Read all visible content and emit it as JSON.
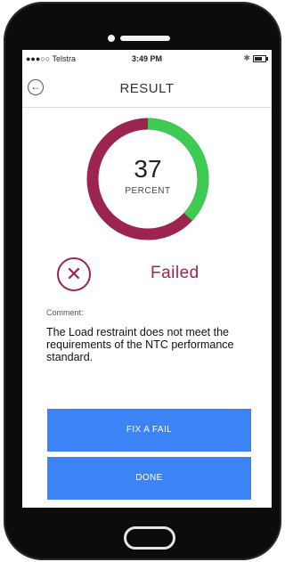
{
  "status_bar": {
    "carrier": "●●●○○ Telstra",
    "time": "3:49 PM",
    "bluetooth_icon": "bluetooth-icon",
    "battery_icon": "battery-icon"
  },
  "header": {
    "title": "RESULT",
    "back_icon": "back-arrow-circle-icon"
  },
  "score": {
    "value": "37",
    "unit": "PERCENT",
    "percent": 37,
    "colors": {
      "pass": "#3ecb54",
      "fail": "#9b2450"
    }
  },
  "result": {
    "label": "Failed",
    "icon": "x-circle-icon",
    "color": "#a0244b"
  },
  "comment": {
    "label": "Comment:",
    "text": "The Load restraint does not meet the requirements of the NTC performance standard."
  },
  "actions": {
    "fix_label": "FIX A FAIL",
    "done_label": "DONE",
    "color": "#3c83f5"
  }
}
